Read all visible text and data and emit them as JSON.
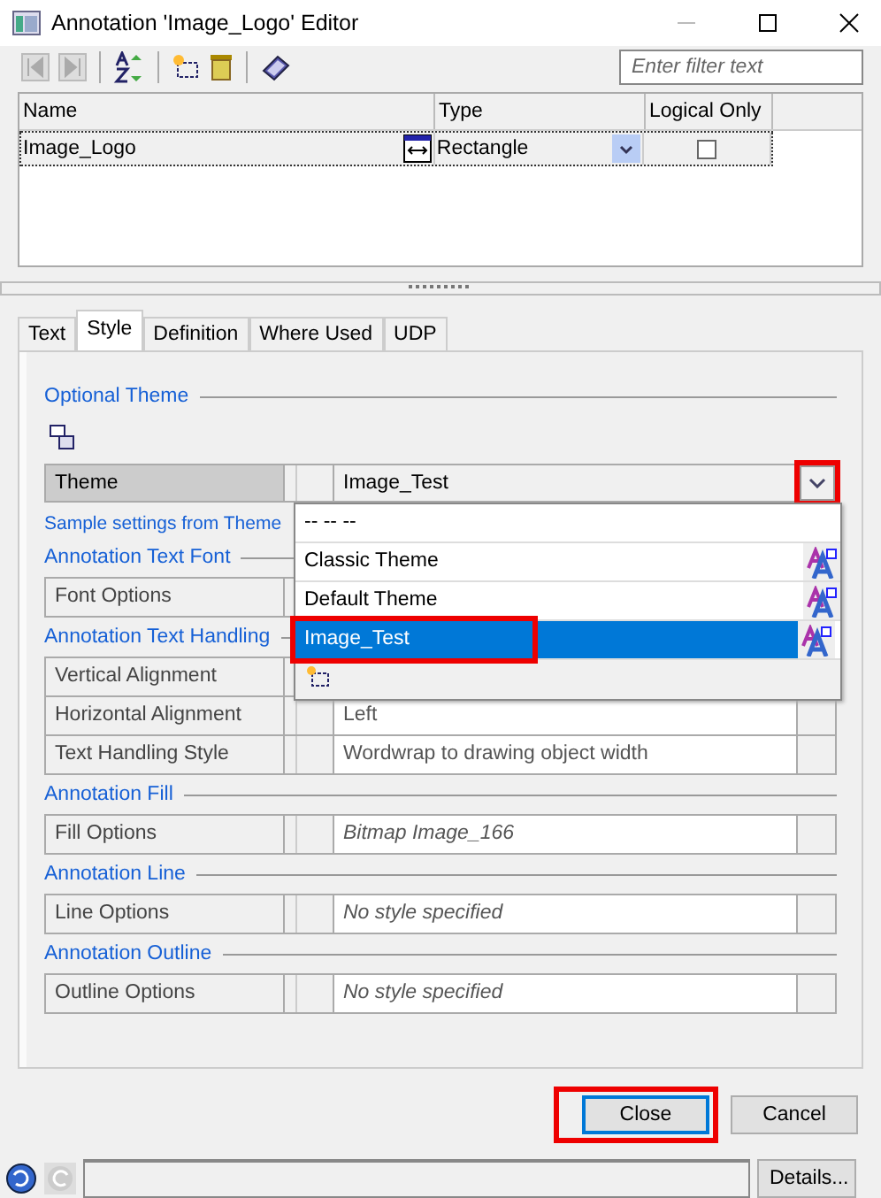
{
  "window": {
    "title": "Annotation 'Image_Logo' Editor"
  },
  "toolbar": {
    "filter_placeholder": "Enter filter text"
  },
  "grid": {
    "columns": [
      "Name",
      "Type",
      "Logical Only"
    ],
    "rows": [
      {
        "name": "Image_Logo",
        "type": "Rectangle",
        "logical_only": false,
        "selected": true
      }
    ]
  },
  "tabs": [
    {
      "label": "Text",
      "selected": false
    },
    {
      "label": "Style",
      "selected": true
    },
    {
      "label": "Definition",
      "selected": false
    },
    {
      "label": "Where Used",
      "selected": false
    },
    {
      "label": "UDP",
      "selected": false
    }
  ],
  "optional_theme": {
    "heading": "Optional Theme",
    "label": "Theme",
    "value": "Image_Test",
    "dropdown_highlighted": true,
    "options": [
      {
        "label": "-- -- --",
        "selected": false,
        "highlighted": false,
        "has_icon": false
      },
      {
        "label": "Classic Theme",
        "selected": false,
        "highlighted": false,
        "has_icon": true
      },
      {
        "label": "Default Theme",
        "selected": false,
        "highlighted": false,
        "has_icon": true
      },
      {
        "label": "Image_Test",
        "selected": true,
        "highlighted": true,
        "has_icon": true
      }
    ]
  },
  "sample_note": "Sample settings from Theme",
  "sections": [
    {
      "heading": "Annotation Text Font",
      "rows": [
        {
          "label": "Font Options"
        }
      ]
    },
    {
      "heading": "Annotation Text Handling",
      "rows": [
        {
          "label": "Vertical Alignment"
        },
        {
          "label": "Horizontal Alignment",
          "value": "Left",
          "italic": false
        },
        {
          "label": "Text Handling Style",
          "value": "Wordwrap to drawing object width",
          "italic": false
        }
      ]
    },
    {
      "heading": "Annotation Fill",
      "rows": [
        {
          "label": "Fill Options",
          "value": "Bitmap Image_166",
          "italic": true
        }
      ]
    },
    {
      "heading": "Annotation Line",
      "rows": [
        {
          "label": "Line Options",
          "value": "No style specified",
          "italic": true
        }
      ]
    },
    {
      "heading": "Annotation Outline",
      "rows": [
        {
          "label": "Outline Options",
          "value": "No style specified",
          "italic": true
        }
      ]
    }
  ],
  "buttons": [
    {
      "label": "Close",
      "highlighted": true,
      "focused": true
    },
    {
      "label": "Cancel",
      "highlighted": false,
      "focused": false
    }
  ],
  "status_bar": {
    "details_button": "Details..."
  }
}
